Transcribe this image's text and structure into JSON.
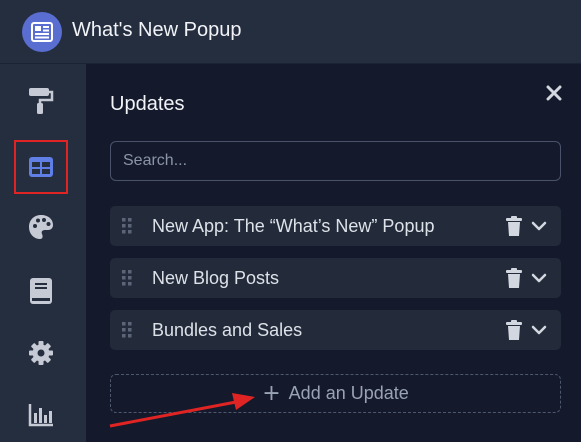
{
  "app": {
    "title": "What's New Popup",
    "logo_icon": "newspaper-icon",
    "accent": "#5a6ed1"
  },
  "sidebar": {
    "items": [
      {
        "icon": "paint-roller-icon",
        "active": false
      },
      {
        "icon": "table-icon",
        "active": true
      },
      {
        "icon": "palette-icon",
        "active": false
      },
      {
        "icon": "book-icon",
        "active": false
      },
      {
        "icon": "gear-icon",
        "active": false
      },
      {
        "icon": "bar-chart-icon",
        "active": false
      }
    ],
    "active_highlight_color": "#e02424"
  },
  "panel": {
    "title": "Updates",
    "close_icon": "close-icon",
    "search": {
      "placeholder": "Search...",
      "value": ""
    },
    "updates": [
      {
        "label": "New App: The “What’s New” Popup"
      },
      {
        "label": "New Blog Posts"
      },
      {
        "label": "Bundles and Sales"
      }
    ],
    "add_button": {
      "label": "Add an Update",
      "icon": "plus-icon"
    }
  },
  "annotation": {
    "type": "arrow",
    "color": "#e02424",
    "points_to": "add-update-button"
  }
}
